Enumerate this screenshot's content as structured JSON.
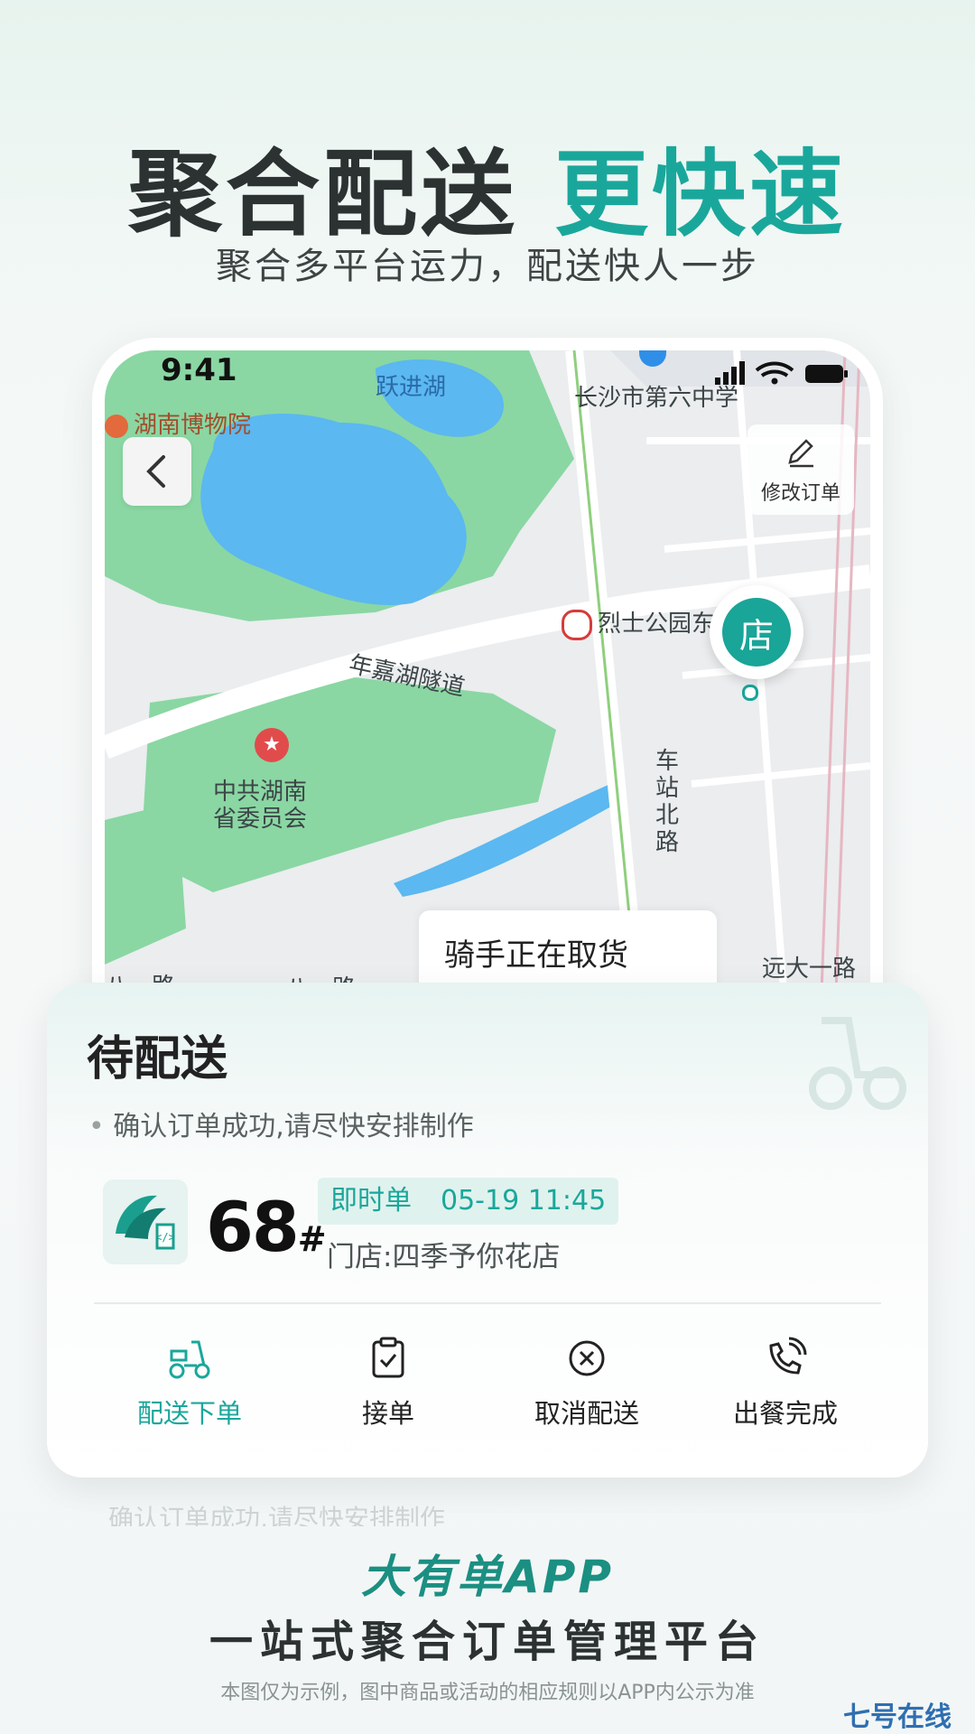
{
  "promo": {
    "headline_a": "聚合配送",
    "headline_b": "更快速",
    "subhead": "聚合多平台运力，配送快人一步",
    "brand": "大有单APP",
    "tagline": "一站式聚合订单管理平台",
    "disclaimer": "本图仅为示例，图中商品或活动的相应规则以APP内公示为准",
    "watermark": "七号在线"
  },
  "status_bar": {
    "time": "9:41"
  },
  "map": {
    "labels": {
      "lake": "跃进湖",
      "museum": "湖南博物院",
      "school": "长沙市第六中学",
      "station": "烈士公园东",
      "tunnel": "年嘉湖隧道",
      "gov": "中共湖南\n省委员会",
      "road_north": "车站北路",
      "road_yuanda": "远大一路",
      "road_bayi_left": "八一路",
      "road_bayi_mid": "八一路"
    },
    "store_pin": "店",
    "edit_order": "修改订单",
    "rider_status": "骑手正在取货"
  },
  "order": {
    "title": "待配送",
    "note": "确认订单成功,请尽快安排制作",
    "number": "68",
    "number_suffix": "#",
    "type": "即时单",
    "time": "05-19 11:45",
    "store": "门店:四季予你花店",
    "ghost_note": "确认订单成功,请尽快安排制作"
  },
  "actions": [
    {
      "label": "配送下单",
      "icon": "scooter-icon"
    },
    {
      "label": "接单",
      "icon": "clipboard-check-icon"
    },
    {
      "label": "取消配送",
      "icon": "cancel-circle-icon"
    },
    {
      "label": "出餐完成",
      "icon": "phone-call-icon"
    }
  ],
  "colors": {
    "accent": "#1aa79b",
    "water": "#5bb8f0",
    "park": "#7fd49a"
  }
}
